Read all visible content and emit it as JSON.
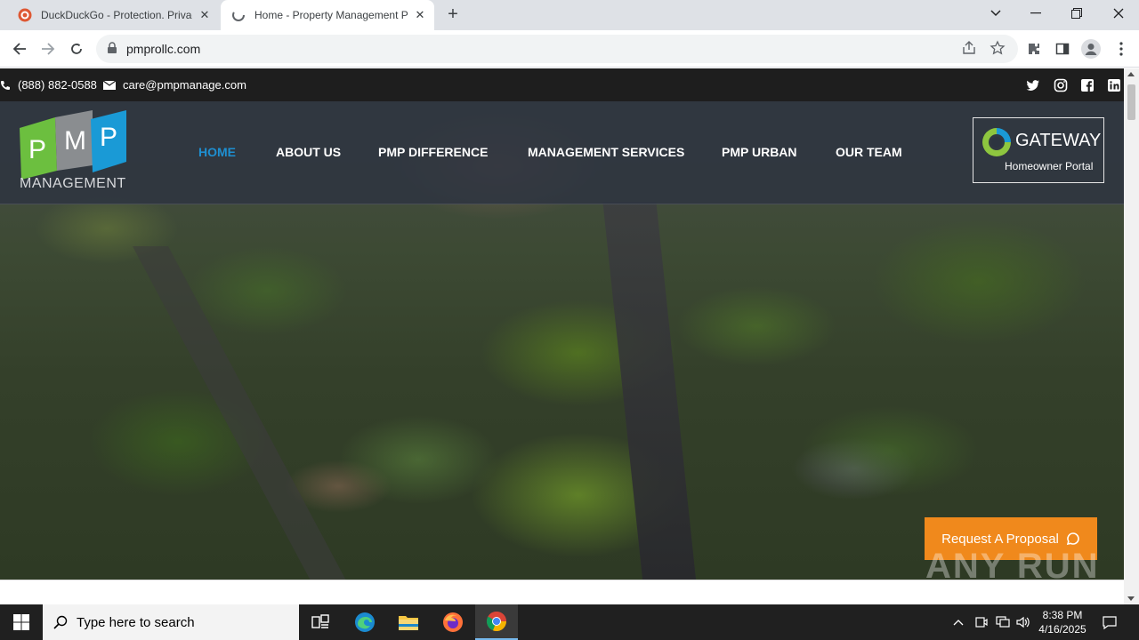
{
  "browser": {
    "tabs": [
      {
        "title": "DuckDuckGo - Protection. Privacy. Peace of mind.",
        "active": false
      },
      {
        "title": "Home - Property Management Professionals",
        "active": true
      }
    ],
    "url": "pmprollc.com"
  },
  "site": {
    "topbar": {
      "phone": "(888) 882-0588",
      "email": "care@pmpmanage.com",
      "social": [
        "twitter-icon",
        "instagram-icon",
        "facebook-icon",
        "linkedin-icon"
      ]
    },
    "logo": {
      "letters": [
        "P",
        "M",
        "P"
      ],
      "subtitle": "MANAGEMENT"
    },
    "nav": [
      {
        "label": "HOME",
        "active": true
      },
      {
        "label": "ABOUT US",
        "active": false
      },
      {
        "label": "PMP DIFFERENCE",
        "active": false
      },
      {
        "label": "MANAGEMENT SERVICES",
        "active": false
      },
      {
        "label": "PMP URBAN",
        "active": false
      },
      {
        "label": "OUR TEAM",
        "active": false
      }
    ],
    "gateway": {
      "title": "GATEWAY",
      "subtitle": "Homeowner Portal"
    },
    "cta": {
      "label": "Request A Proposal"
    },
    "watermark": "ANY RUN"
  },
  "taskbar": {
    "search_placeholder": "Type here to search",
    "time": "8:38 PM",
    "date": "4/16/2025"
  },
  "colors": {
    "accent_nav": "#1e8fd1",
    "cta": "#f0891c",
    "logo_green": "#6cbf3f",
    "logo_gray": "#8a8d90",
    "logo_blue": "#1a9ad6"
  }
}
